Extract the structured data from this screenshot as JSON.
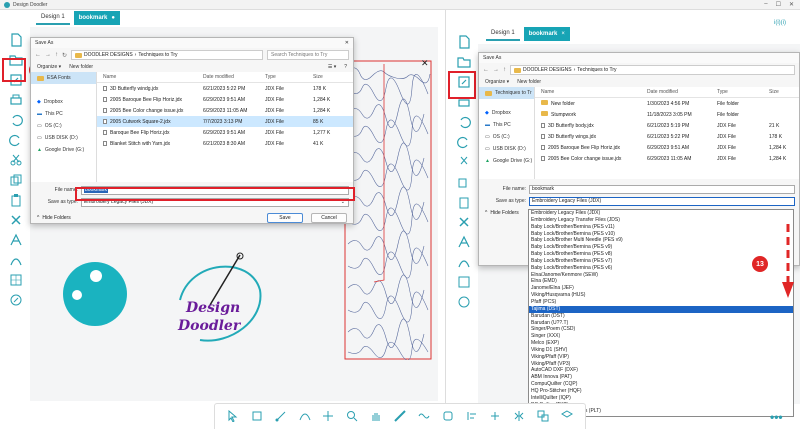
{
  "app": {
    "title": "Design Doodler",
    "win_controls": [
      "–",
      "☐",
      "✕"
    ]
  },
  "left_app": {
    "tabs": [
      {
        "label": "Design 1",
        "active": false
      },
      {
        "label": "bookmark",
        "active": true,
        "close": "●"
      }
    ],
    "step_badge": "12",
    "logo": {
      "line1": "Design",
      "line2": "Doodler"
    }
  },
  "right_app": {
    "tabs": [
      {
        "label": "Design 1",
        "active": false
      },
      {
        "label": "bookmark",
        "active": true,
        "close": "×"
      }
    ],
    "header_right": "i(i)(i)",
    "step_badge": "13"
  },
  "dialog_left": {
    "title": "Save As",
    "close": "✕",
    "breadcrumb": [
      "DOODLER DESIGNS",
      "Techniques to Try"
    ],
    "search_placeholder": "Search Techniques to Try",
    "organize": "Organize ▾",
    "new_folder": "New folder",
    "nav": [
      {
        "label": "ESA Fonts",
        "sel": true
      },
      {
        "label": ""
      },
      {
        "label": "Dropbox"
      },
      {
        "label": "This PC"
      },
      {
        "label": "OS (C:)"
      },
      {
        "label": "USB DISK (D:)"
      },
      {
        "label": "Google Drive (G:)"
      }
    ],
    "columns": [
      "Name",
      "Date modified",
      "Type",
      "Size"
    ],
    "files": [
      {
        "name": "3D Butterfly windg.jdx",
        "date": "6/21/2023 5:22 PM",
        "type": "JDX File",
        "size": "178 K",
        "sel": false
      },
      {
        "name": "2005 Baroque Bee Flip Horiz.jdx",
        "date": "6/29/2023 9:51 AM",
        "type": "JDX File",
        "size": "1,284 K",
        "sel": false
      },
      {
        "name": "2005 Bee Color change issue.jdx",
        "date": "6/29/2023 11:05 AM",
        "type": "JDX File",
        "size": "1,284 K",
        "sel": false
      },
      {
        "name": "2005 Cutwork Square-2.jdx",
        "date": "7/7/2023 3:13 PM",
        "type": "JDX File",
        "size": "85 K",
        "sel": true
      },
      {
        "name": "Baroque Bee Flip Horiz.jdx",
        "date": "6/29/2023 9:51 AM",
        "type": "JDX File",
        "size": "1,277 K",
        "sel": false
      },
      {
        "name": "Blanket Stitch with Yarn.jdx",
        "date": "6/21/2023 8:30 AM",
        "type": "JDX File",
        "size": "41 K",
        "sel": false
      }
    ],
    "file_name_label": "File name:",
    "file_name_value": "bookmark",
    "save_type_label": "Save as type:",
    "save_type_value": "Embroidery Legacy Files (JDX)",
    "hide_folders": "Hide Folders",
    "save": "Save",
    "cancel": "Cancel"
  },
  "dialog_right": {
    "title": "Save As",
    "breadcrumb": [
      "DOODLER DESIGNS",
      "Techniques to Try"
    ],
    "organize": "Organize ▾",
    "new_folder": "New folder",
    "nav": [
      {
        "label": "Techniques to Tr",
        "sel": true
      },
      {
        "label": ""
      },
      {
        "label": "Dropbox"
      },
      {
        "label": "This PC"
      },
      {
        "label": "OS (C:)"
      },
      {
        "label": "USB DISK (D:)"
      },
      {
        "label": "Google Drive (G:)"
      }
    ],
    "columns": [
      "Name",
      "Date modified",
      "Type",
      "Size"
    ],
    "files": [
      {
        "name": "New folder",
        "date": "1/30/2023 4:56 PM",
        "type": "File folder",
        "size": "",
        "folder": true
      },
      {
        "name": "Stumpwork",
        "date": "11/18/2023 3:05 PM",
        "type": "File folder",
        "size": "",
        "folder": true
      },
      {
        "name": "3D Butterfly body.jdx",
        "date": "6/21/2023 5:19 PM",
        "type": "JDX File",
        "size": "21 K",
        "folder": false
      },
      {
        "name": "3D Butterfly wings.jdx",
        "date": "6/21/2023 5:22 PM",
        "type": "JDX File",
        "size": "178 K",
        "folder": false
      },
      {
        "name": "2005 Baroque Bee Flip Horiz.jdx",
        "date": "6/29/2023 9:51 AM",
        "type": "JDX File",
        "size": "1,284 K",
        "folder": false
      },
      {
        "name": "2005 Bee Color change issue.jdx",
        "date": "6/29/2023 11:05 AM",
        "type": "JDX File",
        "size": "1,284 K",
        "folder": false
      }
    ],
    "file_name_label": "File name:",
    "file_name_value": "bookmark",
    "save_type_label": "Save as type:",
    "save_type_value": "Embroidery Legacy Files (JDX)",
    "hide_folders": "Hide Folders",
    "type_options": [
      "Embroidery Legacy Files (JDX)",
      "Embroidery Legacy Transfer Files (JDS)",
      "Baby Lock/Brother/Bernina (PES v11)",
      "Baby Lock/Brother/Bernina (PES v10)",
      "Baby Lock/Brother Multi Needle (PES v9)",
      "Baby Lock/Brother/Bernina (PES v9)",
      "Baby Lock/Brother/Bernina (PES v8)",
      "Baby Lock/Brother/Bernina (PES v7)",
      "Baby Lock/Brother/Bernina (PES v6)",
      "Elna/Janome/Kenmore (SEW)",
      "Elna (EMD)",
      "Janome/Elna (JEF)",
      "Viking/Husqvarna (HUS)",
      "Pfaff (PCS)",
      "Tajima (DST)",
      "Barudan (DST)",
      "Barudan (U??.T)",
      "Singer/Poem (CSD)",
      "Singer (XXX)",
      "Melco (EXP)",
      "Viking D1 (SHV)",
      "Viking/Pfaff (VIP)",
      "Viking/Pfaff (VP3)",
      "AutoCAD DXF (DXF)",
      "ABM Innova (PAT)",
      "CompuQuilter (CQP)",
      "HQ Pro-Stitcher (HQF)",
      "IntelliQuilter (IQP)",
      "PC Quilter (TXT)",
      "CBOT HPGL Plotter Files (PLT)"
    ],
    "selected_option_index": 14
  },
  "colors": {
    "teal": "#17a4b5",
    "red": "#e02626",
    "purple": "#6a1b9a",
    "select_blue": "#1c64c4"
  }
}
